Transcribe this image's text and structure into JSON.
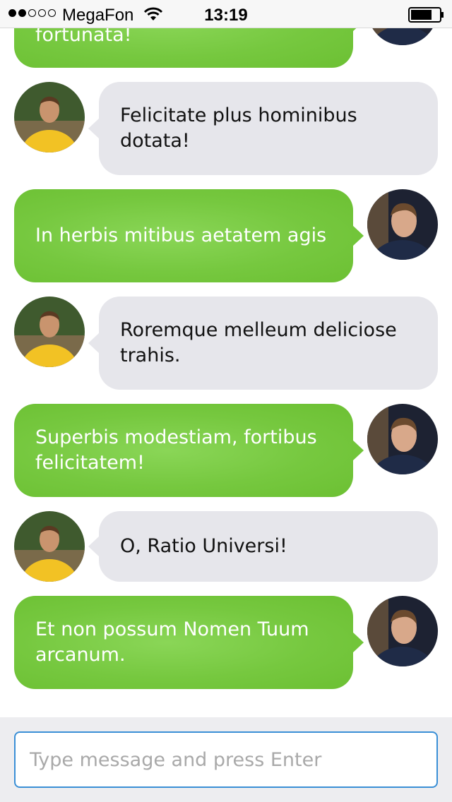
{
  "status_bar": {
    "carrier": "MegaFon",
    "time": "13:19",
    "signal_strength": 2,
    "signal_max": 5,
    "icons": [
      "wifi-icon",
      "battery-icon"
    ]
  },
  "messages": [
    {
      "from": "me",
      "text": "fortunata!"
    },
    {
      "from": "them",
      "text": "Felicitate plus hominibus dotata!"
    },
    {
      "from": "me",
      "text": "In herbis mitibus aetatem agis"
    },
    {
      "from": "them",
      "text": "Roremque melleum deliciose trahis."
    },
    {
      "from": "me",
      "text": "Superbis modestiam, fortibus felicitatem!"
    },
    {
      "from": "them",
      "text": "O, Ratio Universi!"
    },
    {
      "from": "me",
      "text": "Et non possum Nomen Tuum arcanum."
    }
  ],
  "input": {
    "placeholder": "Type message and press Enter",
    "value": ""
  },
  "colors": {
    "outgoing_bubble": "#76c83f",
    "incoming_bubble": "#e6e6eb",
    "input_border": "#3a8fd6"
  }
}
